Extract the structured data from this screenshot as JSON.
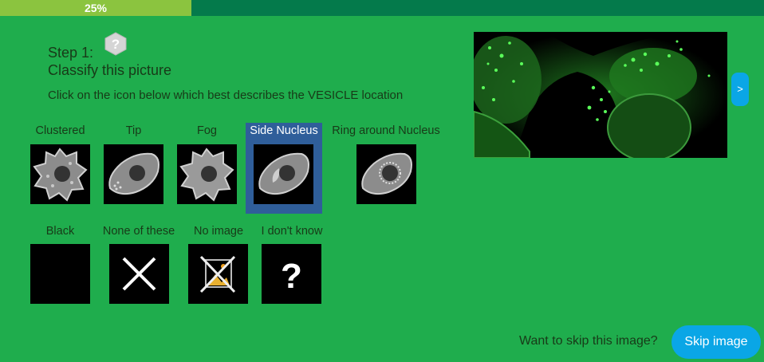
{
  "progress": {
    "label": "25%",
    "fraction": 0.25
  },
  "header": {
    "step": "Step 1:",
    "title": "Classify this picture",
    "instruction": "Click on the icon below which best describes the VESICLE location",
    "help_icon": "question-hexagon-icon"
  },
  "options_row1": [
    {
      "label": "Clustered",
      "icon": "clustered-cell-icon"
    },
    {
      "label": "Tip",
      "icon": "tip-cell-icon"
    },
    {
      "label": "Fog",
      "icon": "fog-cell-icon"
    },
    {
      "label": "Side Nucleus",
      "icon": "side-nucleus-cell-icon",
      "selected": true
    },
    {
      "label": "Ring around Nucleus",
      "icon": "ring-nucleus-cell-icon"
    }
  ],
  "options_row2": [
    {
      "label": "Black",
      "icon": "black-square-icon"
    },
    {
      "label": "None of these",
      "icon": "x-icon"
    },
    {
      "label": "No image",
      "icon": "no-image-icon"
    },
    {
      "label": "I don't know",
      "icon": "question-mark-icon"
    }
  ],
  "next_button": {
    "label": ">"
  },
  "skip": {
    "question": "Want to skip this image?",
    "button": "Skip image"
  },
  "colors": {
    "background": "#1fad4d",
    "progress_fill": "#8bc43f",
    "progress_track": "#047a4b",
    "button": "#0aa6e6",
    "selected": "#2f5e9a"
  }
}
